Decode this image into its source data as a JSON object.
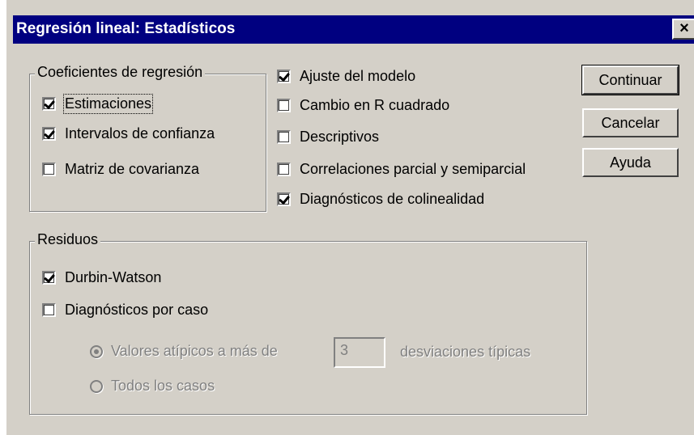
{
  "window": {
    "title": "Regresión lineal: Estadísticos",
    "close_symbol": "×"
  },
  "coeficientes": {
    "label": "Coeficientes de regresión",
    "items": [
      {
        "label": "Estimaciones",
        "checked": true
      },
      {
        "label": "Intervalos de confianza",
        "checked": true
      },
      {
        "label": "Matriz de covarianza",
        "checked": false
      }
    ]
  },
  "opciones": [
    {
      "label": "Ajuste del modelo",
      "checked": true
    },
    {
      "label": "Cambio en R cuadrado",
      "checked": false
    },
    {
      "label": "Descriptivos",
      "checked": false
    },
    {
      "label": "Correlaciones parcial y semiparcial",
      "checked": false
    },
    {
      "label": "Diagnósticos de colinealidad",
      "checked": true
    }
  ],
  "buttons": {
    "continuar": "Continuar",
    "cancelar": "Cancelar",
    "ayuda": "Ayuda"
  },
  "residuos": {
    "label": "Residuos",
    "durbin_watson": {
      "label": "Durbin-Watson",
      "checked": true
    },
    "diag_caso": {
      "label": "Diagnósticos por caso",
      "checked": false
    },
    "valores_atipicos": {
      "label": "Valores atípicos a más de",
      "selected": true,
      "enabled": false
    },
    "desviaciones_value": "3",
    "desviaciones_suffix": "desviaciones típicas",
    "todos_casos": {
      "label": "Todos los casos",
      "selected": false,
      "enabled": false
    }
  }
}
